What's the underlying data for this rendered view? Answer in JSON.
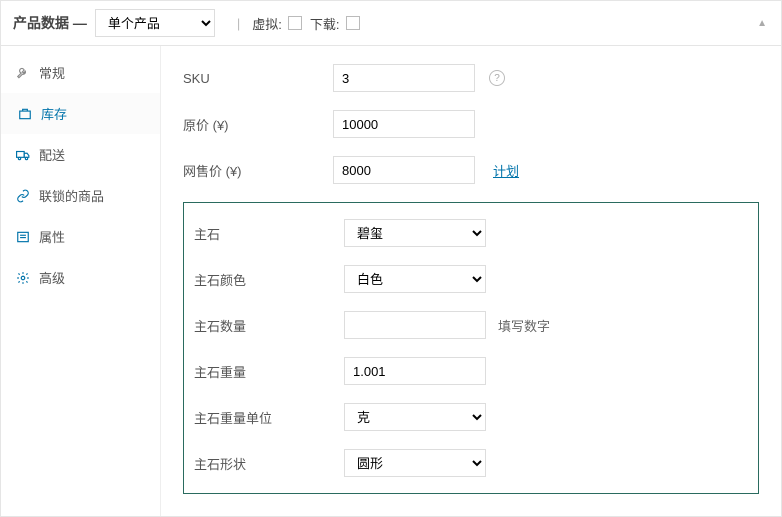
{
  "header": {
    "title": "产品数据 —",
    "type_value": "单个产品",
    "virtual_label": "虚拟:",
    "download_label": "下载:"
  },
  "sidebar": {
    "items": [
      {
        "label": "常规"
      },
      {
        "label": "库存"
      },
      {
        "label": "配送"
      },
      {
        "label": "联锁的商品"
      },
      {
        "label": "属性"
      },
      {
        "label": "高级"
      }
    ]
  },
  "form": {
    "sku_label": "SKU",
    "sku_value": "3",
    "orig_price_label": "原价 (¥)",
    "orig_price_value": "10000",
    "sale_price_label": "网售价 (¥)",
    "sale_price_value": "8000",
    "plan_link": "计划"
  },
  "attrs": {
    "main_stone_label": "主石",
    "main_stone_value": "碧玺",
    "color_label": "主石颜色",
    "color_value": "白色",
    "qty_label": "主石数量",
    "qty_value": "",
    "qty_hint": "填写数字",
    "weight_label": "主石重量",
    "weight_value": "1.001",
    "weight_unit_label": "主石重量单位",
    "weight_unit_value": "克",
    "shape_label": "主石形状",
    "shape_value": "圆形"
  }
}
